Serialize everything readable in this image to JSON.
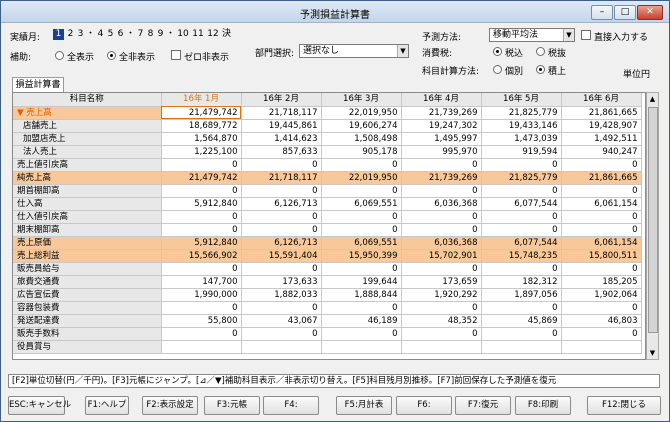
{
  "window": {
    "title": "予測損益計算書",
    "minimize_icon": "minimize-icon",
    "maximize_icon": "maximize-icon",
    "close_icon": "close-icon"
  },
  "controls": {
    "settlement_month_label": "実績月:",
    "months": [
      "1",
      "2",
      "3",
      "・",
      "4",
      "5",
      "6",
      "・",
      "7",
      "8",
      "9",
      "・",
      "10",
      "11",
      "12",
      "決"
    ],
    "selected_month": "1",
    "aux_label": "補助:",
    "radio_show_all": "全表示",
    "radio_show_none": "全非表示",
    "zero_hide_label": "ゼロ非表示",
    "dept_label": "部門選択:",
    "dept_value": "選択なし",
    "forecast_method_label": "予測方法:",
    "forecast_method_value": "移動平均法",
    "direct_input_label": "直接入力する",
    "tax_label": "消費税:",
    "tax_incl": "税込",
    "tax_excl": "税抜",
    "calc_method_label": "科目計算方法:",
    "calc_individual": "個別",
    "calc_cumulative": "積上",
    "unit_label": "単位円"
  },
  "tab": {
    "label": "損益計算書"
  },
  "grid": {
    "header_name": "科目名称",
    "months": [
      "16年 1月",
      "16年 2月",
      "16年 3月",
      "16年 4月",
      "16年 5月",
      "16年 6月"
    ],
    "rows": [
      {
        "name": "売上高",
        "type": "sales",
        "values": [
          "21,479,742",
          "21,718,117",
          "22,019,950",
          "21,739,269",
          "21,825,779",
          "21,861,665"
        ]
      },
      {
        "name": "店舗売上",
        "type": "sub",
        "values": [
          "18,689,772",
          "19,445,861",
          "19,606,274",
          "19,247,302",
          "19,433,146",
          "19,428,907"
        ]
      },
      {
        "name": "加盟店売上",
        "type": "sub",
        "values": [
          "1,564,870",
          "1,414,623",
          "1,508,498",
          "1,495,997",
          "1,473,039",
          "1,492,511"
        ]
      },
      {
        "name": "法人売上",
        "type": "sub",
        "values": [
          "1,225,100",
          "857,633",
          "905,178",
          "995,970",
          "919,594",
          "940,247"
        ]
      },
      {
        "name": "売上値引戻高",
        "type": "normal",
        "values": [
          "0",
          "0",
          "0",
          "0",
          "0",
          "0"
        ]
      },
      {
        "name": "純売上高",
        "type": "hl",
        "values": [
          "21,479,742",
          "21,718,117",
          "22,019,950",
          "21,739,269",
          "21,825,779",
          "21,861,665"
        ]
      },
      {
        "name": "期首棚卸高",
        "type": "normal",
        "values": [
          "0",
          "0",
          "0",
          "0",
          "0",
          "0"
        ]
      },
      {
        "name": "仕入高",
        "type": "normal",
        "values": [
          "5,912,840",
          "6,126,713",
          "6,069,551",
          "6,036,368",
          "6,077,544",
          "6,061,154"
        ]
      },
      {
        "name": "仕入値引戻高",
        "type": "normal",
        "values": [
          "0",
          "0",
          "0",
          "0",
          "0",
          "0"
        ]
      },
      {
        "name": "期末棚卸高",
        "type": "normal",
        "values": [
          "0",
          "0",
          "0",
          "0",
          "0",
          "0"
        ]
      },
      {
        "name": "売上原価",
        "type": "hl",
        "values": [
          "5,912,840",
          "6,126,713",
          "6,069,551",
          "6,036,368",
          "6,077,544",
          "6,061,154"
        ]
      },
      {
        "name": "売上総利益",
        "type": "hl",
        "values": [
          "15,566,902",
          "15,591,404",
          "15,950,399",
          "15,702,901",
          "15,748,235",
          "15,800,511"
        ]
      },
      {
        "name": "販売員給与",
        "type": "normal",
        "values": [
          "0",
          "0",
          "0",
          "0",
          "0",
          "0"
        ]
      },
      {
        "name": "旅費交通費",
        "type": "normal",
        "values": [
          "147,700",
          "173,633",
          "199,644",
          "173,659",
          "182,312",
          "185,205"
        ]
      },
      {
        "name": "広告宣伝費",
        "type": "normal",
        "values": [
          "1,990,000",
          "1,882,033",
          "1,888,844",
          "1,920,292",
          "1,897,056",
          "1,902,064"
        ]
      },
      {
        "name": "容器包装費",
        "type": "normal",
        "values": [
          "0",
          "0",
          "0",
          "0",
          "0",
          "0"
        ]
      },
      {
        "name": "発送配達費",
        "type": "normal",
        "values": [
          "55,800",
          "43,067",
          "46,189",
          "48,352",
          "45,869",
          "46,803"
        ]
      },
      {
        "name": "販売手数料",
        "type": "normal",
        "values": [
          "0",
          "0",
          "0",
          "0",
          "0",
          "0"
        ]
      },
      {
        "name": "役員賞与",
        "type": "normal",
        "values": [
          "",
          "",
          "",
          "",
          "",
          ""
        ]
      }
    ]
  },
  "status_text": "[F2]単位切替(円／千円)。[F3]元帳にジャンプ。[⊿／▼]補助科目表示／非表示切り替え。[F5]科目残月別推移。[F7]前回保存した予測値を復元",
  "fkeys": [
    "ESC:キャンセル",
    "F1:ヘルプ",
    "F2:表示設定",
    "F3:元帳",
    "F4:",
    "F5:月計表",
    "F6:",
    "F7:復元",
    "F8:印刷",
    "F12:閉じる"
  ]
}
